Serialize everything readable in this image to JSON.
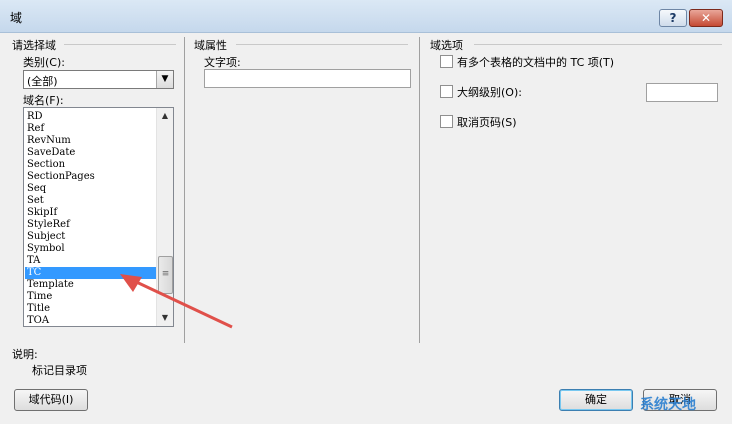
{
  "window": {
    "title": "域"
  },
  "titlebar_buttons": {
    "help": "?",
    "close": "✕"
  },
  "choose_field": {
    "group_label": "请选择域",
    "category_label": "类别(C):",
    "category_value": "(全部)",
    "fieldname_label": "域名(F):",
    "field_names": [
      "RD",
      "Ref",
      "RevNum",
      "SaveDate",
      "Section",
      "SectionPages",
      "Seq",
      "Set",
      "SkipIf",
      "StyleRef",
      "Subject",
      "Symbol",
      "TA",
      "TC",
      "Template",
      "Time",
      "Title",
      "TOA"
    ],
    "selected_field": "TC"
  },
  "field_properties": {
    "group_label": "域属性",
    "text_entry_label": "文字项:",
    "text_entry_value": ""
  },
  "field_options": {
    "group_label": "域选项",
    "options": [
      {
        "label": "有多个表格的文档中的 TC 项(T)",
        "checked": false
      },
      {
        "label": "大纲级别(O):",
        "checked": false
      },
      {
        "label": "取消页码(S)",
        "checked": false
      }
    ],
    "outline_level_value": ""
  },
  "description": {
    "label": "说明:",
    "text": "标记目录项"
  },
  "buttons": {
    "field_codes": "域代码(I)",
    "ok": "确定",
    "cancel": "取消"
  },
  "watermark": "系统天地",
  "icons": [
    "help-icon",
    "close-icon",
    "dropdown-arrow-icon",
    "scroll-up-icon",
    "scroll-down-icon",
    "annotation-arrow"
  ]
}
